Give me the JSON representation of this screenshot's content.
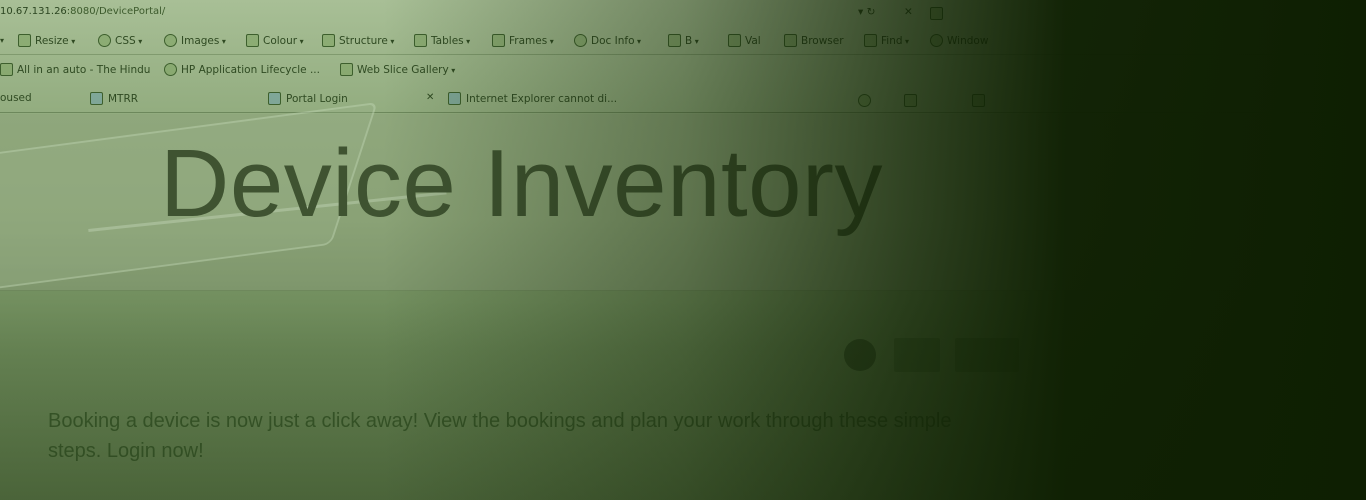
{
  "address_bar": {
    "ip": "10.67.131.26",
    "path": ":8080/DevicePortal/"
  },
  "toolbar": {
    "items": [
      {
        "label": "Resize",
        "icon": "resize-icon"
      },
      {
        "label": "CSS",
        "icon": "css-icon"
      },
      {
        "label": "Images",
        "icon": "images-icon"
      },
      {
        "label": "Colour",
        "icon": "colour-icon"
      },
      {
        "label": "Structure",
        "icon": "structure-icon"
      },
      {
        "label": "Tables",
        "icon": "tables-icon"
      },
      {
        "label": "Frames",
        "icon": "frames-icon"
      },
      {
        "label": "Doc Info",
        "icon": "doc-info-icon"
      },
      {
        "label": "B",
        "icon": "b-icon"
      },
      {
        "label": "Val",
        "icon": "validate-icon"
      },
      {
        "label": "Browser",
        "icon": "browser-icon"
      },
      {
        "label": "Find",
        "icon": "find-icon"
      },
      {
        "label": "Window",
        "icon": "window-icon"
      }
    ]
  },
  "favorites": [
    {
      "label": "All in an auto - The Hindu",
      "icon": "page-icon"
    },
    {
      "label": "HP Application Lifecycle ...",
      "icon": "refresh-page-icon"
    },
    {
      "label": "Web Slice Gallery",
      "icon": "web-slice-icon"
    }
  ],
  "tabs": [
    {
      "label": "oused"
    },
    {
      "label": "MTRR"
    },
    {
      "label": "Portal Login"
    },
    {
      "label": "Internet Explorer cannot di..."
    }
  ],
  "page": {
    "title": "Device Inventory",
    "description": "Booking a device is now just a click away! View the bookings and plan your work through these simple steps. Login now!"
  }
}
